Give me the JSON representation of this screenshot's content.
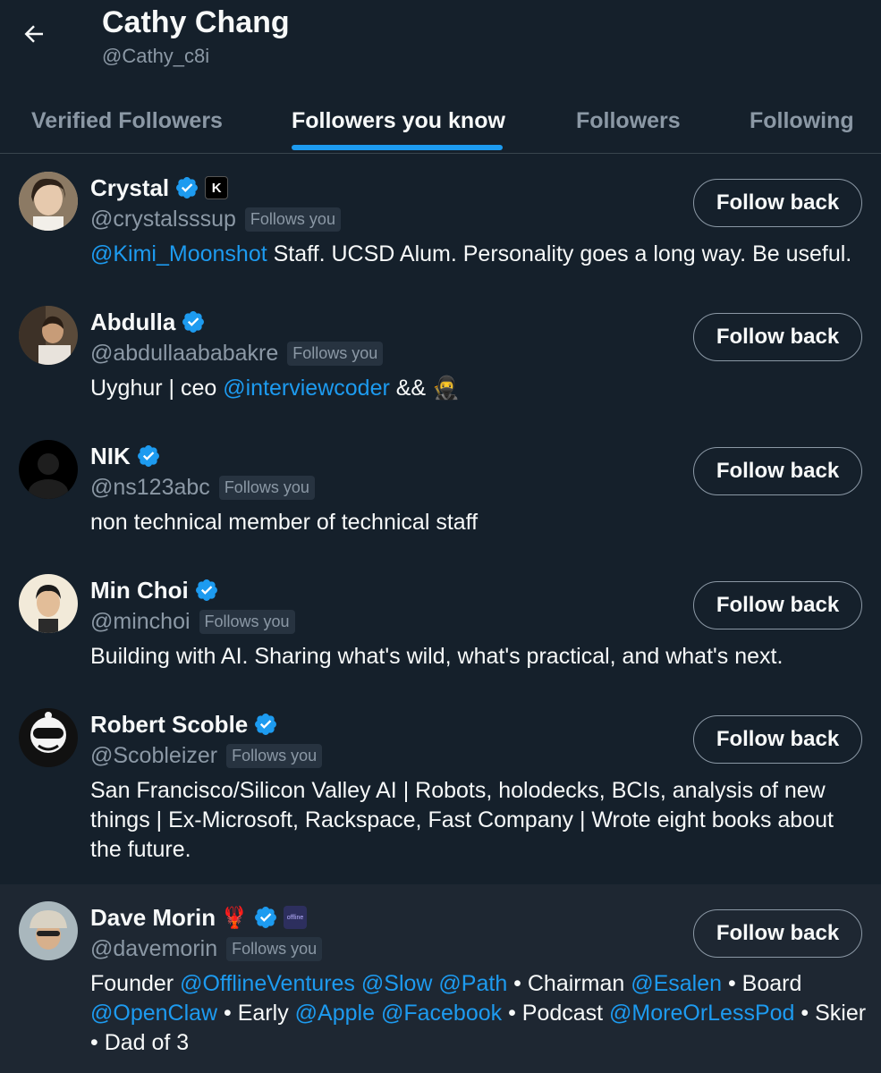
{
  "header": {
    "title": "Cathy Chang",
    "handle": "@Cathy_c8i"
  },
  "tabs": [
    {
      "label": "Verified Followers",
      "active": false
    },
    {
      "label": "Followers you know",
      "active": true
    },
    {
      "label": "Followers",
      "active": false
    },
    {
      "label": "Following",
      "active": false
    }
  ],
  "follows_you_label": "Follows you",
  "follow_back_label": "Follow back",
  "colors": {
    "background": "#15202b",
    "accent": "#1d9bf0",
    "muted": "#8b98a5"
  },
  "users": [
    {
      "name": "Crystal",
      "handle": "@crystalsssup",
      "verified": true,
      "affiliate_badge": "K",
      "bio": [
        {
          "text": "@Kimi_Moonshot",
          "mention": true
        },
        {
          "text": " Staff. UCSD Alum. Personality goes a long way. Be useful.",
          "mention": false
        }
      ]
    },
    {
      "name": "Abdulla",
      "handle": "@abdullaababakre",
      "verified": true,
      "bio": [
        {
          "text": "Uyghur | ceo ",
          "mention": false
        },
        {
          "text": "@interviewcoder",
          "mention": true
        },
        {
          "text": " && 🥷",
          "mention": false
        }
      ]
    },
    {
      "name": "NIK",
      "handle": "@ns123abc",
      "verified": true,
      "bio": [
        {
          "text": "non technical member of technical staff",
          "mention": false
        }
      ]
    },
    {
      "name": "Min Choi",
      "handle": "@minchoi",
      "verified": true,
      "bio": [
        {
          "text": "Building with AI. Sharing what's wild, what's practical, and what's next.",
          "mention": false
        }
      ]
    },
    {
      "name": "Robert Scoble",
      "handle": "@Scobleizer",
      "verified": true,
      "bio": [
        {
          "text": "San Francisco/Silicon Valley AI | Robots, holodecks, BCIs, analysis of new things | Ex-Microsoft, Rackspace, Fast Company | Wrote eight books about the future.",
          "mention": false
        }
      ]
    },
    {
      "name": "Dave Morin",
      "name_emoji": "🦞",
      "handle": "@davemorin",
      "verified": true,
      "affiliate_badge": "offline",
      "bio": [
        {
          "text": "Founder ",
          "mention": false
        },
        {
          "text": "@OfflineVentures",
          "mention": true
        },
        {
          "text": " ",
          "mention": false
        },
        {
          "text": "@Slow",
          "mention": true
        },
        {
          "text": " ",
          "mention": false
        },
        {
          "text": "@Path",
          "mention": true
        },
        {
          "text": " • Chairman ",
          "mention": false
        },
        {
          "text": "@Esalen",
          "mention": true
        },
        {
          "text": " • Board ",
          "mention": false
        },
        {
          "text": "@OpenClaw",
          "mention": true
        },
        {
          "text": " • Early ",
          "mention": false
        },
        {
          "text": "@Apple",
          "mention": true
        },
        {
          "text": " ",
          "mention": false
        },
        {
          "text": "@Facebook",
          "mention": true
        },
        {
          "text": " • Podcast ",
          "mention": false
        },
        {
          "text": "@MoreOrLessPod",
          "mention": true
        },
        {
          "text": " • Skier • Dad of 3",
          "mention": false
        }
      ]
    }
  ]
}
